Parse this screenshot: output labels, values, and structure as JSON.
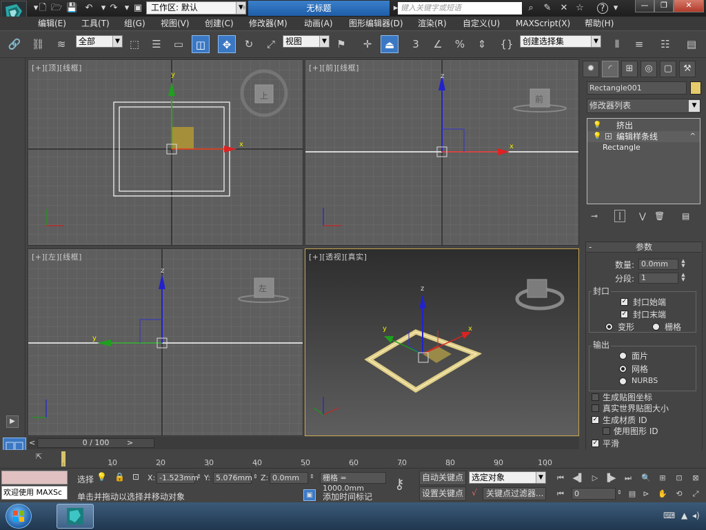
{
  "titlebar": {
    "workspace_label": "工作区: 默认",
    "doc_title": "无标题",
    "search_placeholder": "键入关键字或短语",
    "help_icon": "?"
  },
  "menu": {
    "items": [
      "编辑(E)",
      "工具(T)",
      "组(G)",
      "视图(V)",
      "创建(C)",
      "修改器(M)",
      "动画(A)",
      "图形编辑器(D)",
      "渲染(R)",
      "自定义(U)",
      "MAXScript(X)",
      "帮助(H)"
    ]
  },
  "toolbar": {
    "selection_filter": "全部",
    "ref_coord": "视图",
    "named_selection": "创建选择集",
    "snap_label": "3",
    "angle_snap_label": "%"
  },
  "viewports": {
    "top": {
      "label": "[+][顶][线框]",
      "cube": "上",
      "x_axis": "x",
      "y_axis": "y"
    },
    "front": {
      "label": "[+][前][线框]",
      "cube": "前",
      "x_axis": "x",
      "z_axis": "z"
    },
    "left": {
      "label": "[+][左][线框]",
      "cube": "左",
      "y_axis": "y",
      "z_axis": "z"
    },
    "persp": {
      "label": "[+][透视][真实]",
      "x_axis": "x",
      "y_axis": "y",
      "z_axis": "z"
    }
  },
  "command_panel": {
    "object_name": "Rectangle001",
    "object_color": "#e5cb6b",
    "modifier_list": "修改器列表",
    "stack": [
      "挤出",
      "编辑样条线",
      "Rectangle"
    ],
    "params_title": "参数",
    "amount_label": "数量:",
    "amount_value": "0.0mm",
    "segments_label": "分段:",
    "segments_value": "1",
    "capping_title": "封口",
    "cap_start": "封口始端",
    "cap_end": "封口末端",
    "morph": "变形",
    "grid": "栅格",
    "output_title": "输出",
    "patch": "面片",
    "mesh": "网格",
    "nurbs": "NURBS",
    "gen_map_coords": "生成贴图坐标",
    "real_world_map": "真实世界贴图大小",
    "gen_mat_ids": "生成材质 ID",
    "use_shape_ids": "使用图形 ID",
    "smooth": "平滑"
  },
  "timeline": {
    "frame": "0 / 100",
    "ticks": [
      "10",
      "20",
      "30",
      "40",
      "50",
      "60",
      "70",
      "80",
      "90",
      "100"
    ]
  },
  "status": {
    "welcome": "欢迎使用 MAXSc",
    "selection_label": "选择",
    "x_label": "X:",
    "x_value": "-1.523mm",
    "y_label": "Y:",
    "y_value": "5.076mm",
    "z_label": "Z:",
    "z_value": "0.0mm",
    "grid": "栅格 = 1000.0mm",
    "prompt": "单击并拖动以选择并移动对象",
    "add_time_tag": "添加时间标记",
    "auto_key": "自动关键点",
    "set_key": "设置关键点",
    "key_mode": "选定对象",
    "key_filters": "关键点过滤器...",
    "current_frame": "0"
  }
}
